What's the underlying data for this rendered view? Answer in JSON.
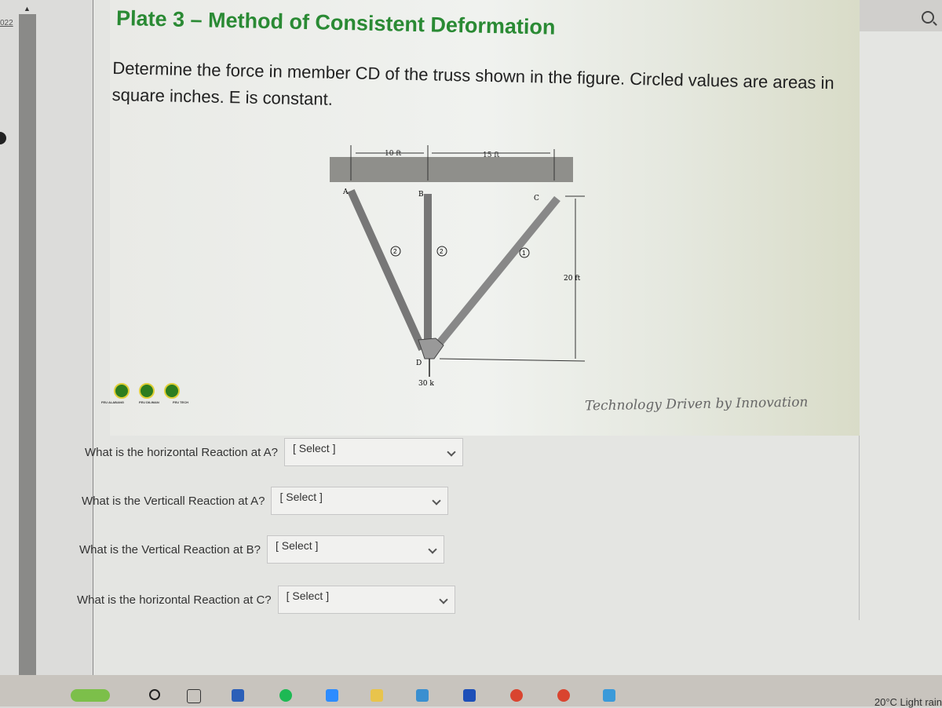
{
  "sidebar": {
    "date_fragment": "022"
  },
  "plate": {
    "title": "Plate 3 – Method of Consistent Deformation",
    "problem": "Determine the force in member CD of the truss shown in the figure. Circled values are areas in square inches. E is constant.",
    "figure": {
      "dim_left": "10 ft",
      "dim_right": "15 ft",
      "dim_height": "20 ft",
      "load": "30 k",
      "nodes": [
        "A",
        "B",
        "C",
        "D"
      ],
      "areas": {
        "AD": "2",
        "BD": "2",
        "CD": "1"
      }
    },
    "logos": [
      {
        "label": "FEU ALABANG"
      },
      {
        "label": "FEU DILIMAN"
      },
      {
        "label": "FEU TECH"
      }
    ],
    "tagline": "Technology Driven by Innovation"
  },
  "questions": [
    {
      "label": "What is the horizontal Reaction at A?",
      "value": "[ Select ]"
    },
    {
      "label": "What is the Verticall Reaction at A?",
      "value": "[ Select ]"
    },
    {
      "label": "What is the Vertical Reaction at B?",
      "value": "[ Select ]"
    },
    {
      "label": "What is the horizontal Reaction at C?",
      "value": "[ Select ]"
    }
  ],
  "taskbar": {
    "apps": [
      "widgets",
      "cortana",
      "task-view",
      "word",
      "spotify",
      "zoom",
      "file-explorer",
      "mail",
      "app",
      "chrome",
      "chrome",
      "photos"
    ],
    "weather": "20°C Light rain"
  }
}
